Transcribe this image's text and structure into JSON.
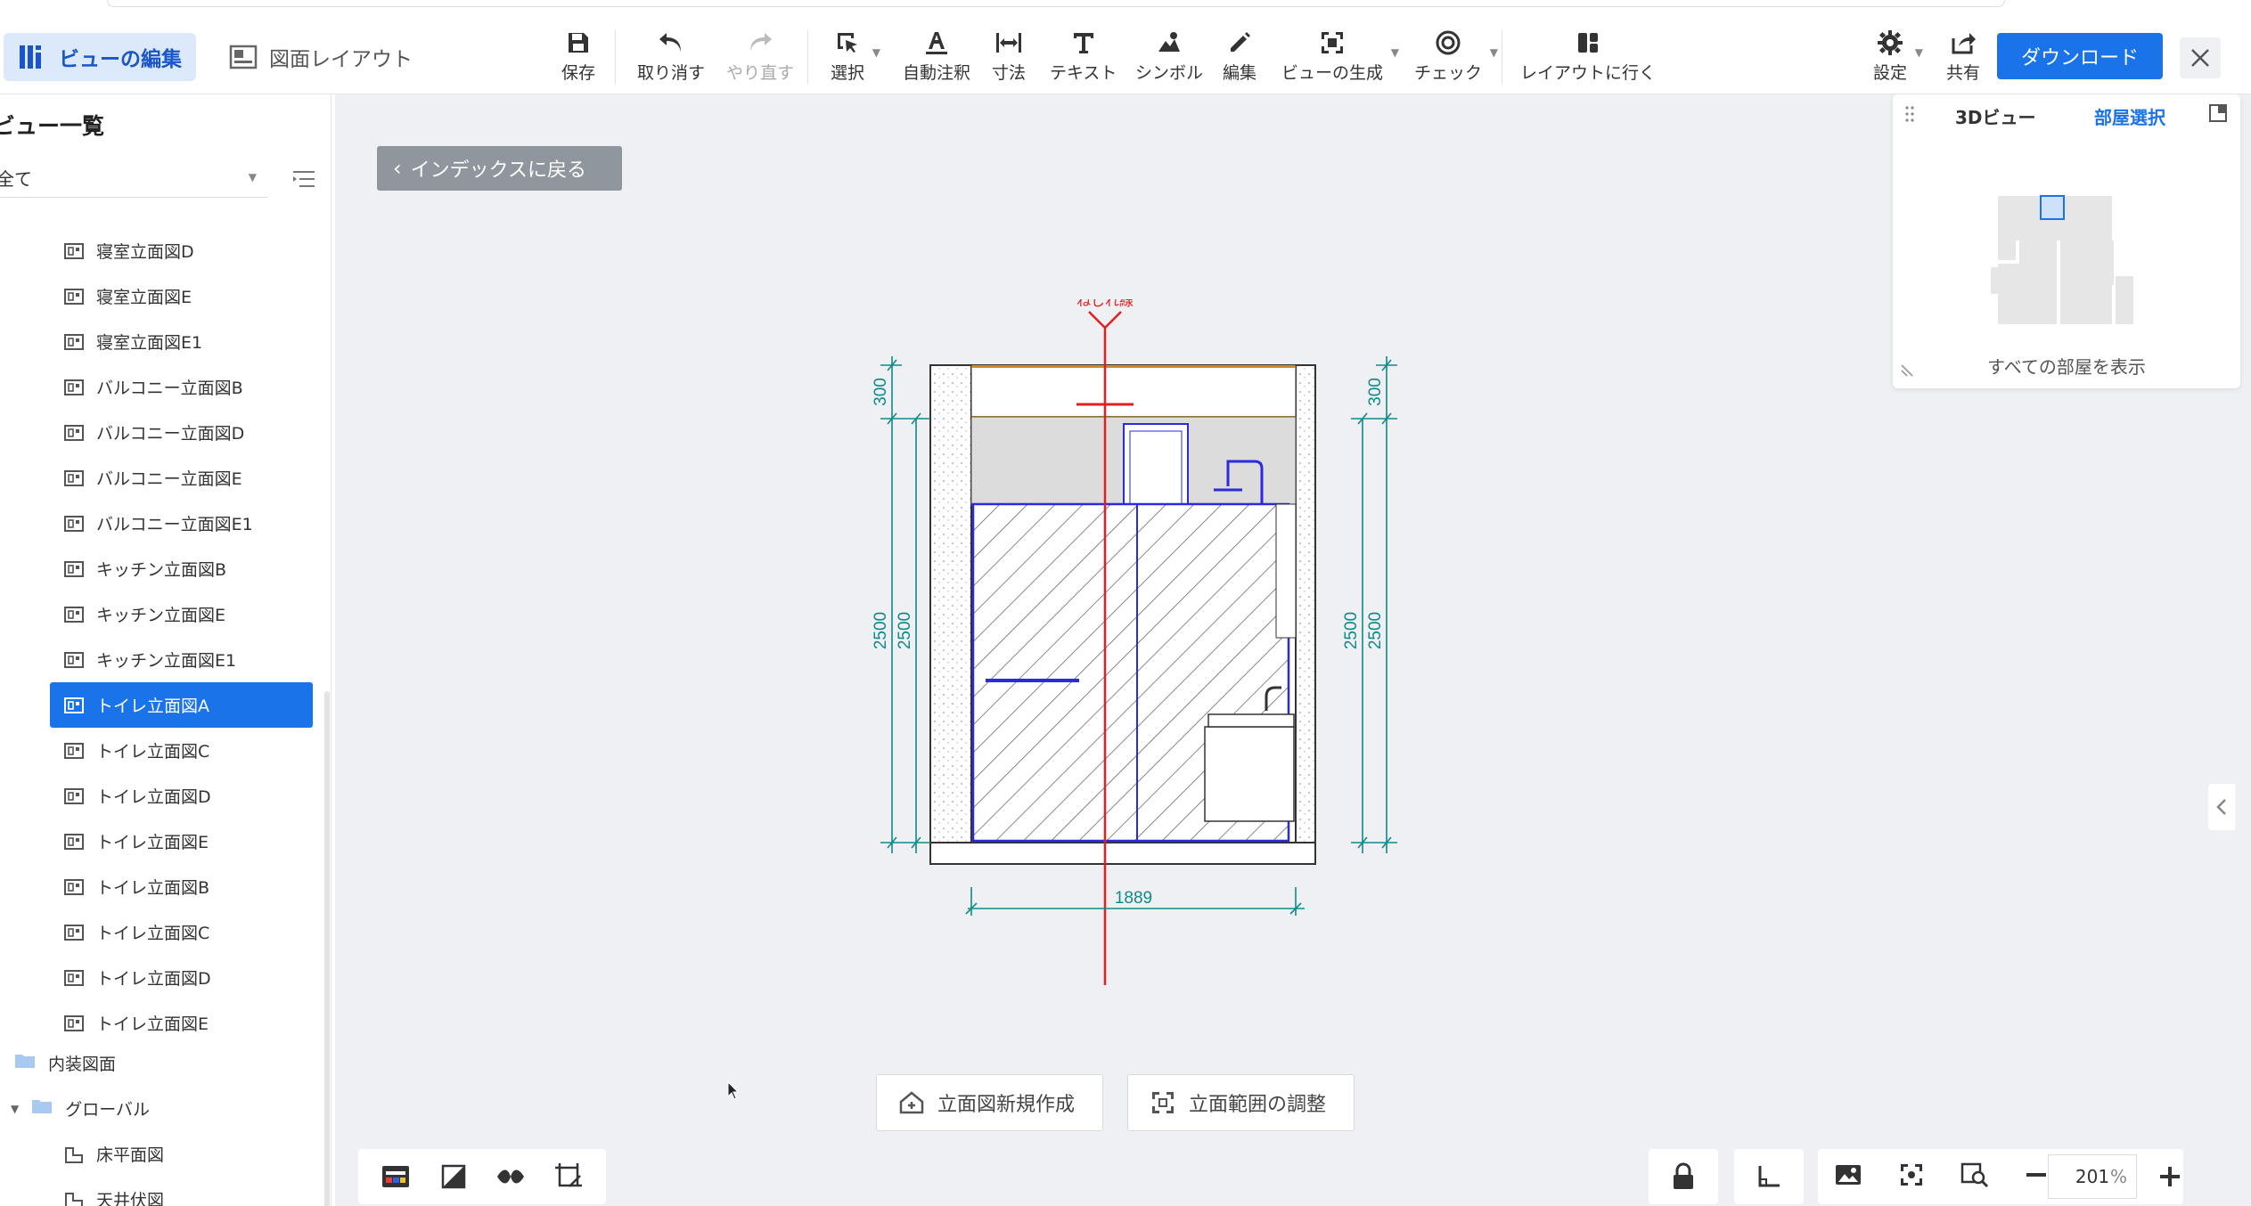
{
  "header": {
    "mode_edit_view": "ビューの編集",
    "mode_layout": "図面レイアウト",
    "tools": {
      "save": "保存",
      "undo": "取り消す",
      "redo": "やり直す",
      "select": "選択",
      "auto_annotate": "自動注釈",
      "dimension": "寸法",
      "text": "テキスト",
      "symbol": "シンボル",
      "edit": "編集",
      "generate_view": "ビューの生成",
      "check": "チェック",
      "go_layout": "レイアウトに行く",
      "settings": "設定",
      "share": "共有"
    },
    "download": "ダウンロード"
  },
  "sidebar": {
    "title": "ビュー一覧",
    "filter_value": "全て",
    "items": [
      {
        "label": "寝室立面図D"
      },
      {
        "label": "寝室立面図E"
      },
      {
        "label": "寝室立面図E1"
      },
      {
        "label": "バルコニー立面図B"
      },
      {
        "label": "バルコニー立面図D"
      },
      {
        "label": "バルコニー立面図E"
      },
      {
        "label": "バルコニー立面図E1"
      },
      {
        "label": "キッチン立面図B"
      },
      {
        "label": "キッチン立面図E"
      },
      {
        "label": "キッチン立面図E1"
      },
      {
        "label": "トイレ立面図A"
      },
      {
        "label": "トイレ立面図C"
      },
      {
        "label": "トイレ立面図D"
      },
      {
        "label": "トイレ立面図E"
      },
      {
        "label": "トイレ立面図B"
      },
      {
        "label": "トイレ立面図C"
      },
      {
        "label": "トイレ立面図D"
      },
      {
        "label": "トイレ立面図E"
      }
    ],
    "selected_index": 10,
    "folders": {
      "interior": "内装図面",
      "global": "グローバル",
      "floor_plan": "床平面図",
      "ceiling_plan": "天井伏図"
    }
  },
  "canvas": {
    "back_button": "インデックスに戻る",
    "drawing": {
      "section_label": "ねじれ線",
      "dim_top_left": "300",
      "dim_main_left_outer": "2500",
      "dim_main_left_inner": "2500",
      "dim_top_right": "300",
      "dim_main_right_inner": "2500",
      "dim_main_right_outer": "2500",
      "dim_width": "1889"
    },
    "new_elevation": "立面図新規作成",
    "adjust_range": "立面範囲の調整",
    "zoom_value": "201",
    "zoom_unit": "%"
  },
  "panel3d": {
    "tab_3d": "3Dビュー",
    "tab_room": "部屋選択",
    "show_all": "すべての部屋を表示"
  },
  "colors": {
    "accent": "#1a73e8",
    "dimension": "#0e8a8a",
    "section_line": "#e02020",
    "fixture_line": "#2a2ae0"
  }
}
